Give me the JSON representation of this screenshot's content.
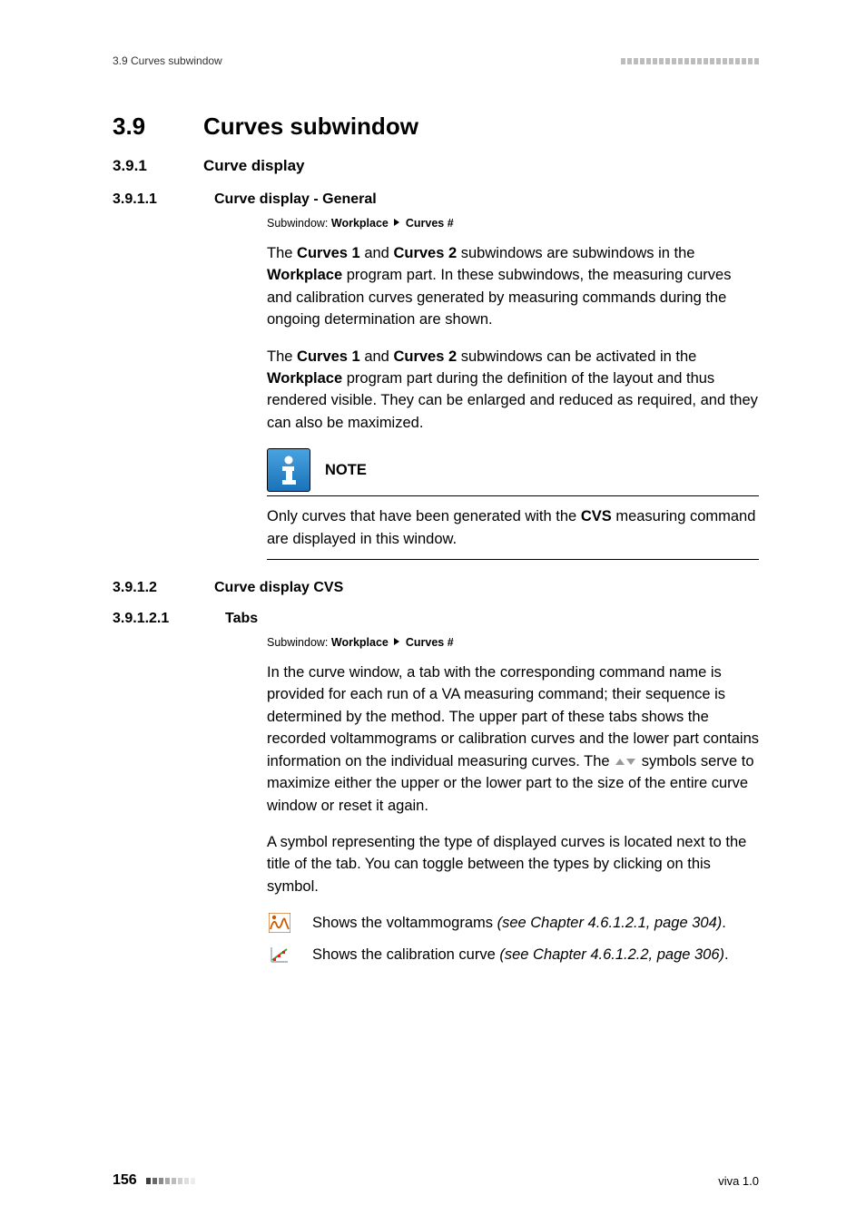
{
  "header": {
    "left": "3.9 Curves subwindow"
  },
  "h1": {
    "num": "3.9",
    "title": "Curves subwindow"
  },
  "h2": {
    "num": "3.9.1",
    "title": "Curve display"
  },
  "h3_1": {
    "num": "3.9.1.1",
    "title": "Curve display - General"
  },
  "path1": {
    "prefix": "Subwindow: ",
    "a": "Workplace",
    "b": "Curves #"
  },
  "p1": {
    "t0": "The ",
    "b1": "Curves 1",
    "t1": " and ",
    "b2": "Curves 2",
    "t2": " subwindows are subwindows in the ",
    "b3": "Workplace",
    "t3": " program part. In these subwindows, the measuring curves and calibration curves generated by measuring commands during the ongoing determination are shown."
  },
  "p2": {
    "t0": "The ",
    "b1": "Curves 1",
    "t1": " and ",
    "b2": "Curves 2",
    "t2": " subwindows can be activated in the ",
    "b3": "Workplace",
    "t3": " program part during the definition of the layout and thus rendered visible. They can be enlarged and reduced as required, and they can also be maximized."
  },
  "note": {
    "label": "NOTE",
    "t0": "Only curves that have been generated with the ",
    "b1": "CVS",
    "t1": " measuring command are displayed in this window."
  },
  "h3_2": {
    "num": "3.9.1.2",
    "title": "Curve display CVS"
  },
  "h4": {
    "num": "3.9.1.2.1",
    "title": "Tabs"
  },
  "path2": {
    "prefix": "Subwindow: ",
    "a": "Workplace",
    "b": "Curves #"
  },
  "p3": {
    "t0": "In the curve window, a tab with the corresponding command name is provided for each run of a VA measuring command; their sequence is determined by the method. The upper part of these tabs shows the recorded voltammograms or calibration curves and the lower part contains information on the individual measuring curves. The ",
    "t1": " symbols serve to maximize either the upper or the lower part to the size of the entire curve window or reset it again."
  },
  "p4": "A symbol representing the type of displayed curves is located next to the title of the tab. You can toggle between the types by clicking on this symbol.",
  "iconrow1": {
    "t0": "Shows the voltammograms ",
    "i1": "(see Chapter 4.6.1.2.1, page 304)",
    "t1": "."
  },
  "iconrow2": {
    "t0": "Shows the calibration curve ",
    "i1": "(see Chapter 4.6.1.2.2, page 306)",
    "t1": "."
  },
  "footer": {
    "page": "156",
    "right": "viva 1.0"
  }
}
